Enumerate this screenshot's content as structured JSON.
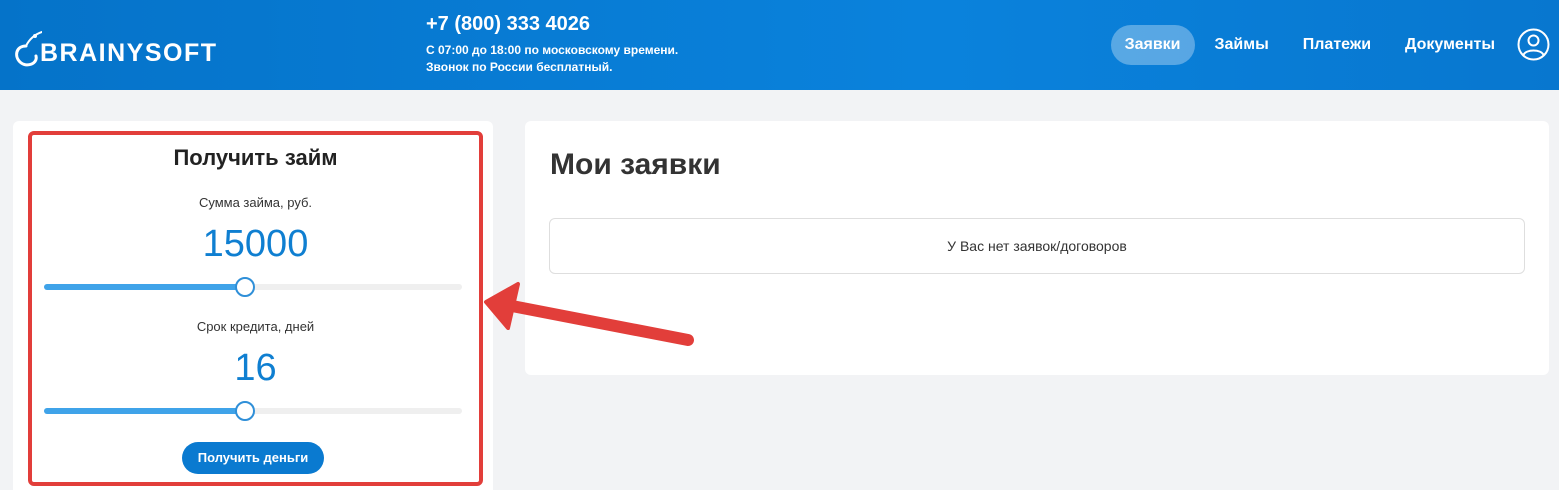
{
  "header": {
    "logo_text": "BRAINYSOFT",
    "phone": "+7 (800) 333 4026",
    "hours_line1": "С 07:00 до 18:00 по московскому времени.",
    "hours_line2": "Звонок по России бесплатный.",
    "nav": [
      {
        "label": "Заявки",
        "active": true
      },
      {
        "label": "Займы",
        "active": false
      },
      {
        "label": "Платежи",
        "active": false
      },
      {
        "label": "Документы",
        "active": false
      }
    ],
    "user_icon": "user-circle-icon"
  },
  "loan_form": {
    "title": "Получить займ",
    "amount_label": "Сумма займа, руб.",
    "amount_value": "15000",
    "amount_slider_fraction": 0.48,
    "term_label": "Срок кредита, дней",
    "term_value": "16",
    "term_slider_fraction": 0.48,
    "submit_label": "Получить деньги"
  },
  "applications": {
    "title": "Мои заявки",
    "empty_message": "У Вас нет заявок/договоров"
  },
  "colors": {
    "header_blue": "#0a7ad0",
    "accent_blue": "#0f7fd1",
    "highlight_red": "#e23e3a"
  }
}
